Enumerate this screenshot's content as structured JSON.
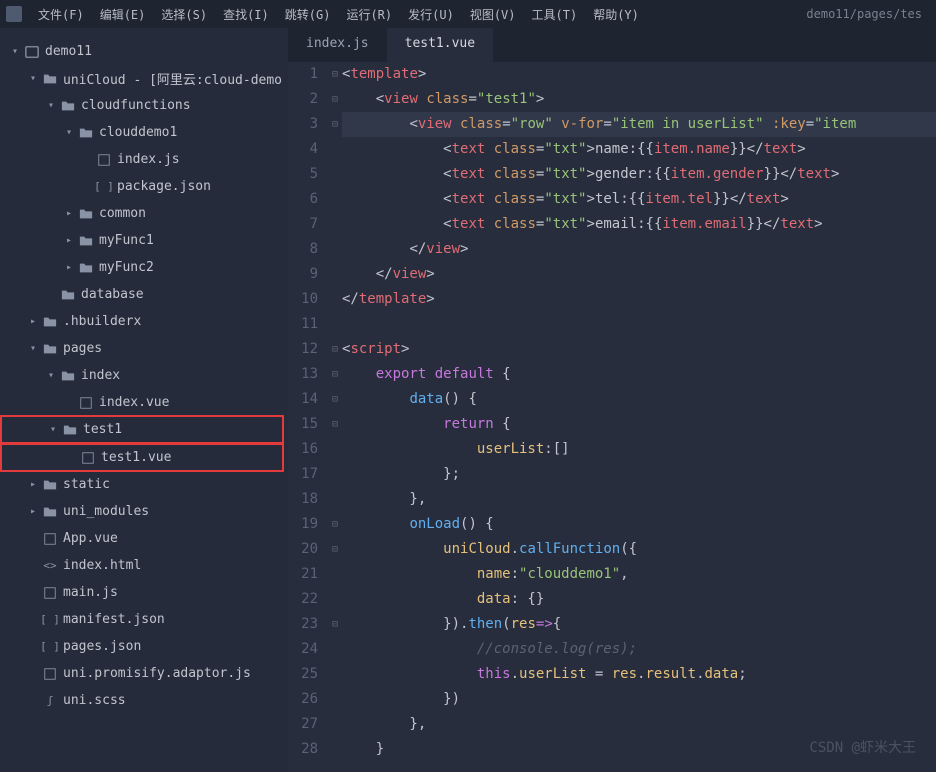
{
  "menu": {
    "items": [
      "文件(F)",
      "编辑(E)",
      "选择(S)",
      "查找(I)",
      "跳转(G)",
      "运行(R)",
      "发行(U)",
      "视图(V)",
      "工具(T)",
      "帮助(Y)"
    ]
  },
  "breadcrumb": "demo11/pages/tes",
  "tree": [
    {
      "indent": 0,
      "chev": "v",
      "ico": "project",
      "label": "demo11"
    },
    {
      "indent": 1,
      "chev": "v",
      "ico": "folder",
      "label": "uniCloud - [阿里云:cloud-demo"
    },
    {
      "indent": 2,
      "chev": "v",
      "ico": "folder",
      "label": "cloudfunctions"
    },
    {
      "indent": 3,
      "chev": "v",
      "ico": "folder",
      "label": "clouddemo1"
    },
    {
      "indent": 4,
      "chev": "",
      "ico": "js",
      "label": "index.js"
    },
    {
      "indent": 4,
      "chev": "",
      "ico": "json",
      "label": "package.json"
    },
    {
      "indent": 3,
      "chev": ">",
      "ico": "folder",
      "label": "common"
    },
    {
      "indent": 3,
      "chev": ">",
      "ico": "folder",
      "label": "myFunc1"
    },
    {
      "indent": 3,
      "chev": ">",
      "ico": "folder",
      "label": "myFunc2"
    },
    {
      "indent": 2,
      "chev": "",
      "ico": "folder",
      "label": "database"
    },
    {
      "indent": 1,
      "chev": ">",
      "ico": "folder",
      "label": ".hbuilderx"
    },
    {
      "indent": 1,
      "chev": "v",
      "ico": "folder",
      "label": "pages"
    },
    {
      "indent": 2,
      "chev": "v",
      "ico": "folder",
      "label": "index"
    },
    {
      "indent": 3,
      "chev": "",
      "ico": "vue",
      "label": "index.vue"
    },
    {
      "indent": 2,
      "chev": "v",
      "ico": "folder",
      "label": "test1",
      "hl": true
    },
    {
      "indent": 3,
      "chev": "",
      "ico": "vue",
      "label": "test1.vue",
      "hl": true
    },
    {
      "indent": 1,
      "chev": ">",
      "ico": "folder",
      "label": "static"
    },
    {
      "indent": 1,
      "chev": ">",
      "ico": "folder",
      "label": "uni_modules"
    },
    {
      "indent": 1,
      "chev": "",
      "ico": "vue",
      "label": "App.vue"
    },
    {
      "indent": 1,
      "chev": "",
      "ico": "html",
      "label": "index.html"
    },
    {
      "indent": 1,
      "chev": "",
      "ico": "js",
      "label": "main.js"
    },
    {
      "indent": 1,
      "chev": "",
      "ico": "json",
      "label": "manifest.json"
    },
    {
      "indent": 1,
      "chev": "",
      "ico": "json",
      "label": "pages.json"
    },
    {
      "indent": 1,
      "chev": "",
      "ico": "js",
      "label": "uni.promisify.adaptor.js"
    },
    {
      "indent": 1,
      "chev": "",
      "ico": "scss",
      "label": "uni.scss"
    }
  ],
  "tabs": [
    {
      "label": "index.js",
      "active": false
    },
    {
      "label": "test1.vue",
      "active": true
    }
  ],
  "code": {
    "lineCount": 28,
    "foldMarks": {
      "1": "⊟",
      "2": "⊟",
      "3": "⊟",
      "12": "⊟",
      "13": "⊟",
      "14": "⊟",
      "15": "⊟",
      "19": "⊟",
      "20": "⊟",
      "23": "⊟"
    },
    "lines": [
      {
        "n": 1,
        "hl": 0,
        "seg": [
          [
            "<",
            "p"
          ],
          [
            "template",
            "t"
          ],
          [
            ">",
            "p"
          ]
        ]
      },
      {
        "n": 2,
        "hl": 0,
        "seg": [
          [
            "    ",
            "p"
          ],
          [
            "<",
            "p"
          ],
          [
            "view",
            "t"
          ],
          [
            " ",
            "p"
          ],
          [
            "class",
            "a"
          ],
          [
            "=",
            "p"
          ],
          [
            "\"test1\"",
            "s"
          ],
          [
            ">",
            "p"
          ]
        ]
      },
      {
        "n": 3,
        "hl": 2,
        "seg": [
          [
            "        ",
            "p"
          ],
          [
            "<",
            "p"
          ],
          [
            "view",
            "t"
          ],
          [
            " ",
            "p"
          ],
          [
            "class",
            "a"
          ],
          [
            "=",
            "p"
          ],
          [
            "\"row\"",
            "s"
          ],
          [
            " ",
            "p"
          ],
          [
            "v-for",
            "a"
          ],
          [
            "=",
            "p"
          ],
          [
            "\"item in userList\"",
            "s"
          ],
          [
            " ",
            "p"
          ],
          [
            ":key",
            "a"
          ],
          [
            "=",
            "p"
          ],
          [
            "\"item",
            "s"
          ]
        ]
      },
      {
        "n": 4,
        "hl": 0,
        "seg": [
          [
            "            ",
            "p"
          ],
          [
            "<",
            "p"
          ],
          [
            "text",
            "t"
          ],
          [
            " ",
            "p"
          ],
          [
            "class",
            "a"
          ],
          [
            "=",
            "p"
          ],
          [
            "\"txt\"",
            "s"
          ],
          [
            ">",
            "p"
          ],
          [
            "name:{{",
            "p"
          ],
          [
            "item.name",
            "i"
          ],
          [
            "}}",
            "p"
          ],
          [
            "</",
            "p"
          ],
          [
            "text",
            "t"
          ],
          [
            ">",
            "p"
          ]
        ]
      },
      {
        "n": 5,
        "hl": 0,
        "seg": [
          [
            "            ",
            "p"
          ],
          [
            "<",
            "p"
          ],
          [
            "text",
            "t"
          ],
          [
            " ",
            "p"
          ],
          [
            "class",
            "a"
          ],
          [
            "=",
            "p"
          ],
          [
            "\"txt\"",
            "s"
          ],
          [
            ">",
            "p"
          ],
          [
            "gender:{{",
            "p"
          ],
          [
            "item.gender",
            "i"
          ],
          [
            "}}",
            "p"
          ],
          [
            "</",
            "p"
          ],
          [
            "text",
            "t"
          ],
          [
            ">",
            "p"
          ]
        ]
      },
      {
        "n": 6,
        "hl": 0,
        "seg": [
          [
            "            ",
            "p"
          ],
          [
            "<",
            "p"
          ],
          [
            "text",
            "t"
          ],
          [
            " ",
            "p"
          ],
          [
            "class",
            "a"
          ],
          [
            "=",
            "p"
          ],
          [
            "\"txt\"",
            "s"
          ],
          [
            ">",
            "p"
          ],
          [
            "tel:{{",
            "p"
          ],
          [
            "item.tel",
            "i"
          ],
          [
            "}}",
            "p"
          ],
          [
            "</",
            "p"
          ],
          [
            "text",
            "t"
          ],
          [
            ">",
            "p"
          ]
        ]
      },
      {
        "n": 7,
        "hl": 0,
        "seg": [
          [
            "            ",
            "p"
          ],
          [
            "<",
            "p"
          ],
          [
            "text",
            "t"
          ],
          [
            " ",
            "p"
          ],
          [
            "class",
            "a"
          ],
          [
            "=",
            "p"
          ],
          [
            "\"txt\"",
            "s"
          ],
          [
            ">",
            "p"
          ],
          [
            "email:{{",
            "p"
          ],
          [
            "item.email",
            "i"
          ],
          [
            "}}",
            "p"
          ],
          [
            "</",
            "p"
          ],
          [
            "text",
            "t"
          ],
          [
            ">",
            "p"
          ]
        ]
      },
      {
        "n": 8,
        "hl": 0,
        "seg": [
          [
            "        ",
            "p"
          ],
          [
            "</",
            "p"
          ],
          [
            "view",
            "t"
          ],
          [
            ">",
            "p"
          ]
        ]
      },
      {
        "n": 9,
        "hl": 0,
        "seg": [
          [
            "    ",
            "p"
          ],
          [
            "</",
            "p"
          ],
          [
            "view",
            "t"
          ],
          [
            ">",
            "p"
          ]
        ]
      },
      {
        "n": 10,
        "hl": 0,
        "seg": [
          [
            "</",
            "p"
          ],
          [
            "template",
            "t"
          ],
          [
            ">",
            "p"
          ]
        ]
      },
      {
        "n": 11,
        "hl": 0,
        "seg": []
      },
      {
        "n": 12,
        "hl": 0,
        "seg": [
          [
            "<",
            "p"
          ],
          [
            "script",
            "t"
          ],
          [
            ">",
            "p"
          ]
        ]
      },
      {
        "n": 13,
        "hl": 0,
        "seg": [
          [
            "    ",
            "p"
          ],
          [
            "export",
            "k"
          ],
          [
            " ",
            "p"
          ],
          [
            "default",
            "k"
          ],
          [
            " {",
            "p"
          ]
        ]
      },
      {
        "n": 14,
        "hl": 0,
        "seg": [
          [
            "        ",
            "p"
          ],
          [
            "data",
            "f"
          ],
          [
            "() {",
            "p"
          ]
        ]
      },
      {
        "n": 15,
        "hl": 0,
        "seg": [
          [
            "            ",
            "p"
          ],
          [
            "return",
            "k"
          ],
          [
            " {",
            "p"
          ]
        ]
      },
      {
        "n": 16,
        "hl": 0,
        "seg": [
          [
            "                ",
            "p"
          ],
          [
            "userList",
            "v"
          ],
          [
            ":[]",
            "p"
          ]
        ]
      },
      {
        "n": 17,
        "hl": 0,
        "seg": [
          [
            "            };",
            "p"
          ]
        ]
      },
      {
        "n": 18,
        "hl": 0,
        "seg": [
          [
            "        },",
            "p"
          ]
        ]
      },
      {
        "n": 19,
        "hl": 0,
        "seg": [
          [
            "        ",
            "p"
          ],
          [
            "onLoad",
            "f"
          ],
          [
            "() {",
            "p"
          ]
        ]
      },
      {
        "n": 20,
        "hl": 0,
        "seg": [
          [
            "            ",
            "p"
          ],
          [
            "uniCloud",
            "v"
          ],
          [
            ".",
            "p"
          ],
          [
            "callFunction",
            "f"
          ],
          [
            "({",
            "p"
          ]
        ]
      },
      {
        "n": 21,
        "hl": 0,
        "seg": [
          [
            "                ",
            "p"
          ],
          [
            "name",
            "v"
          ],
          [
            ":",
            "p"
          ],
          [
            "\"clouddemo1\"",
            "s"
          ],
          [
            ",",
            "p"
          ]
        ]
      },
      {
        "n": 22,
        "hl": 0,
        "seg": [
          [
            "                ",
            "p"
          ],
          [
            "data",
            "v"
          ],
          [
            ": {}",
            "p"
          ]
        ]
      },
      {
        "n": 23,
        "hl": 0,
        "seg": [
          [
            "            }).",
            "p"
          ],
          [
            "then",
            "f"
          ],
          [
            "(",
            "p"
          ],
          [
            "res",
            "v"
          ],
          [
            "=>",
            "k"
          ],
          [
            "{",
            "p"
          ]
        ]
      },
      {
        "n": 24,
        "hl": 0,
        "seg": [
          [
            "                ",
            "p"
          ],
          [
            "//console.log(res);",
            "c"
          ]
        ]
      },
      {
        "n": 25,
        "hl": 0,
        "seg": [
          [
            "                ",
            "p"
          ],
          [
            "this",
            "k"
          ],
          [
            ".",
            "p"
          ],
          [
            "userList",
            "v"
          ],
          [
            " = ",
            "p"
          ],
          [
            "res",
            "v"
          ],
          [
            ".",
            "p"
          ],
          [
            "result",
            "v"
          ],
          [
            ".",
            "p"
          ],
          [
            "data",
            "v"
          ],
          [
            ";",
            "p"
          ]
        ]
      },
      {
        "n": 26,
        "hl": 0,
        "seg": [
          [
            "            })",
            "p"
          ]
        ]
      },
      {
        "n": 27,
        "hl": 0,
        "seg": [
          [
            "        },",
            "p"
          ]
        ]
      },
      {
        "n": 28,
        "hl": 0,
        "seg": [
          [
            "    }",
            "p"
          ]
        ]
      }
    ]
  },
  "watermark": "CSDN @虾米大王"
}
